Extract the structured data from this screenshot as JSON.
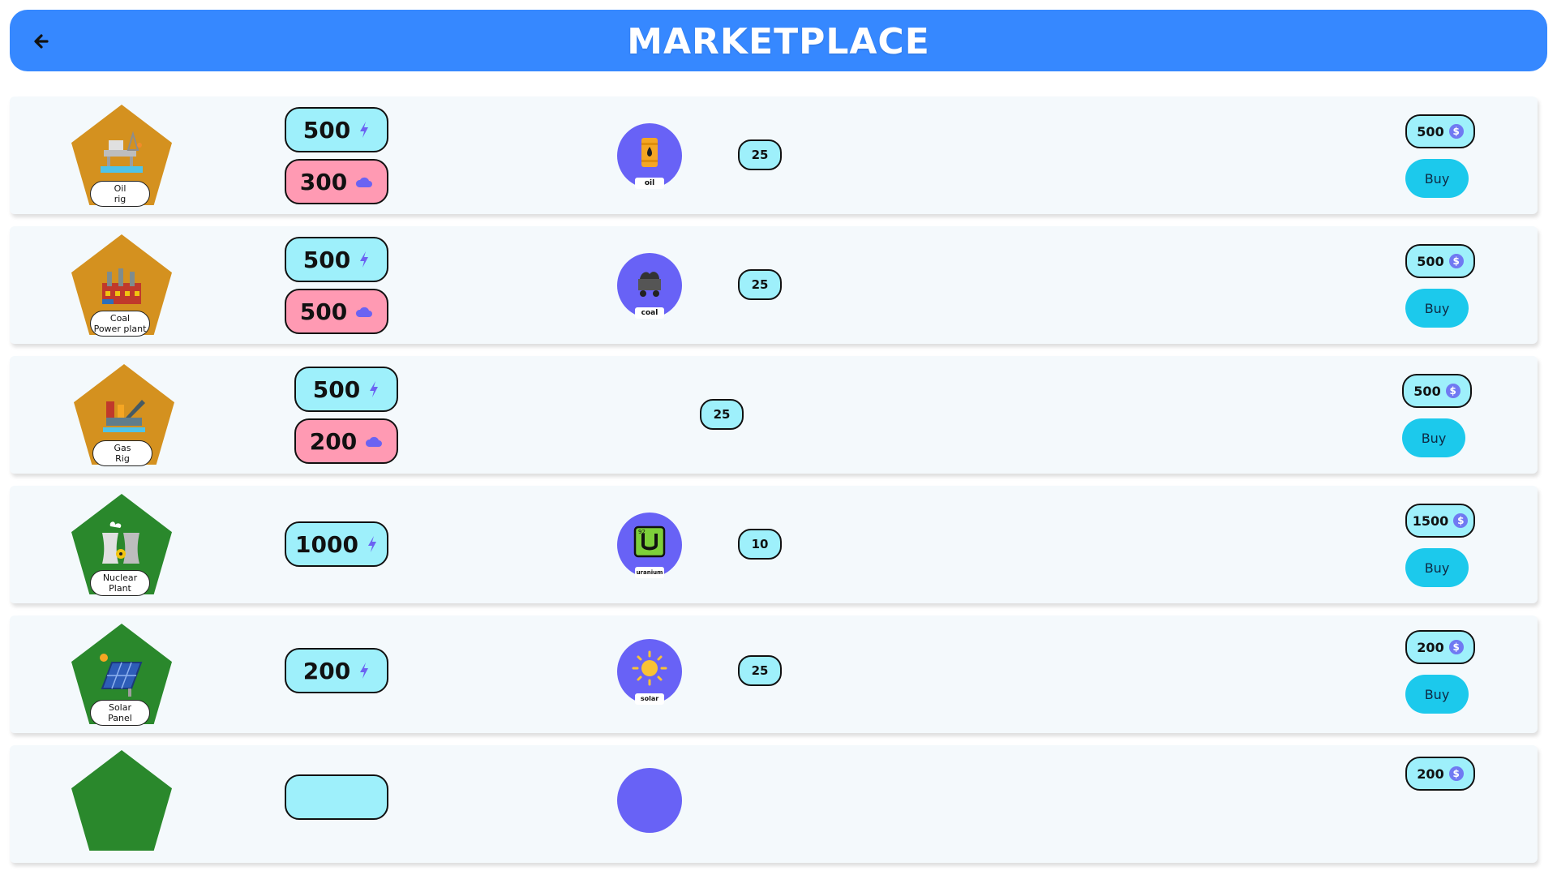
{
  "header": {
    "title": "MARKETPLACE",
    "back_icon": "arrow-left-icon",
    "color": "#3688ff"
  },
  "plants": [
    {
      "name_line1": "Oil",
      "name_line2": "rig",
      "energy": "500",
      "co2": "300",
      "resource": "oil",
      "quantity": "25",
      "price": "500",
      "buy_label": "Buy"
    },
    {
      "name_line1": "Coal",
      "name_line2": "Power plant",
      "energy": "500",
      "co2": "500",
      "resource": "coal",
      "quantity": "25",
      "price": "500",
      "buy_label": "Buy"
    },
    {
      "name_line1": "Gas",
      "name_line2": "Rig",
      "energy": "500",
      "co2": "200",
      "quantity": "25",
      "price": "500",
      "buy_label": "Buy"
    },
    {
      "name_line1": "Nuclear",
      "name_line2": "Plant",
      "energy": "1000",
      "resource": "uranium",
      "quantity": "10",
      "price": "1500",
      "buy_label": "Buy"
    },
    {
      "name_line1": "Solar",
      "name_line2": "Panel",
      "energy": "200",
      "resource": "solar",
      "quantity": "25",
      "price": "200",
      "buy_label": "Buy"
    },
    {
      "energy": "",
      "price": "200"
    }
  ],
  "colors": {
    "energy_pill": "#9ef0fb",
    "co2_pill": "#ff9ab3",
    "fossil_badge": "#d4911f",
    "renewable_badge": "#2a882c",
    "resource_circle": "#6862f6",
    "buy_button": "#1cc9ec"
  }
}
